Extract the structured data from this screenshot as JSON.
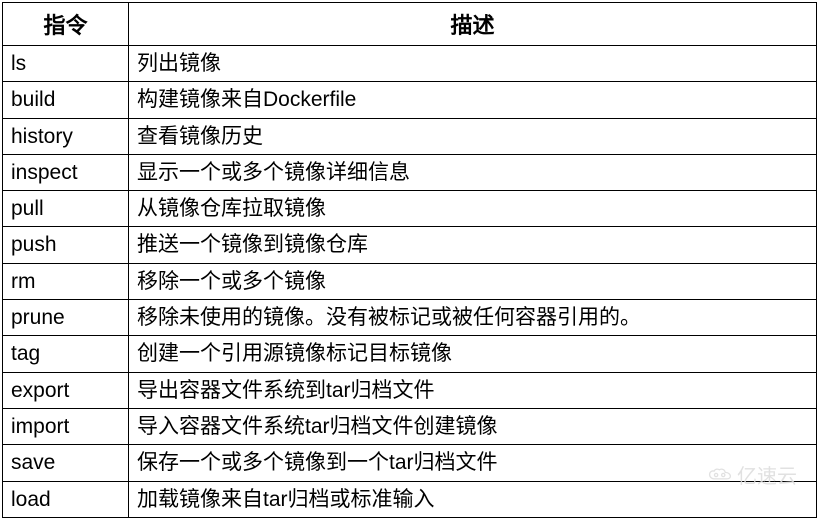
{
  "table": {
    "headers": {
      "command": "指令",
      "description": "描述"
    },
    "rows": [
      {
        "command": "ls",
        "description": "列出镜像"
      },
      {
        "command": "build",
        "description": "构建镜像来自Dockerfile"
      },
      {
        "command": "history",
        "description": "查看镜像历史"
      },
      {
        "command": "inspect",
        "description": "显示一个或多个镜像详细信息"
      },
      {
        "command": "pull",
        "description": "从镜像仓库拉取镜像"
      },
      {
        "command": "push",
        "description": "推送一个镜像到镜像仓库"
      },
      {
        "command": "rm",
        "description": "移除一个或多个镜像"
      },
      {
        "command": "prune",
        "description": "移除未使用的镜像。没有被标记或被任何容器引用的。"
      },
      {
        "command": "tag",
        "description": "创建一个引用源镜像标记目标镜像"
      },
      {
        "command": "export",
        "description": "导出容器文件系统到tar归档文件"
      },
      {
        "command": "import",
        "description": "导入容器文件系统tar归档文件创建镜像"
      },
      {
        "command": "save",
        "description": "保存一个或多个镜像到一个tar归档文件"
      },
      {
        "command": "load",
        "description": "加载镜像来自tar归档或标准输入"
      }
    ]
  },
  "watermark": {
    "text": "亿速云"
  }
}
